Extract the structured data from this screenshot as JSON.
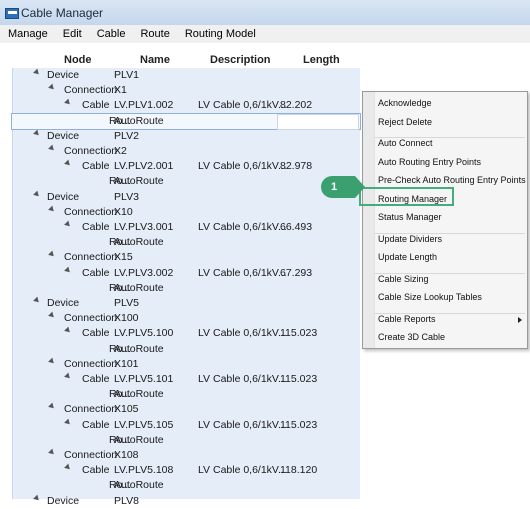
{
  "window": {
    "title": "Cable Manager"
  },
  "menubar": {
    "items": [
      "Manage",
      "Edit",
      "Cable",
      "Route",
      "Routing Model"
    ]
  },
  "grid": {
    "columns": [
      "Node",
      "Name",
      "Description",
      "Length"
    ],
    "rows": [
      {
        "node": "Device",
        "name": "PLV1",
        "desc": "",
        "len": "",
        "level": 0
      },
      {
        "node": "Connection",
        "name": "X1",
        "desc": "",
        "len": "",
        "level": 1
      },
      {
        "node": "Cable",
        "name": "LV.PLV1.002",
        "desc": "LV Cable 0,6/1kV...",
        "len": "82.202",
        "level": 2
      },
      {
        "node": "Ro...",
        "name": "AutoRoute",
        "desc": "",
        "len": "",
        "level": 3,
        "selected": true
      },
      {
        "node": "Device",
        "name": "PLV2",
        "desc": "",
        "len": "",
        "level": 0
      },
      {
        "node": "Connection",
        "name": "X2",
        "desc": "",
        "len": "",
        "level": 1
      },
      {
        "node": "Cable",
        "name": "LV.PLV2.001",
        "desc": "LV Cable 0,6/1kV...",
        "len": "82.978",
        "level": 2
      },
      {
        "node": "Ro...",
        "name": "AutoRoute",
        "desc": "",
        "len": "",
        "level": 3
      },
      {
        "node": "Device",
        "name": "PLV3",
        "desc": "",
        "len": "",
        "level": 0
      },
      {
        "node": "Connection",
        "name": "X10",
        "desc": "",
        "len": "",
        "level": 1
      },
      {
        "node": "Cable",
        "name": "LV.PLV3.001",
        "desc": "LV Cable 0,6/1kV...",
        "len": "66.493",
        "level": 2
      },
      {
        "node": "Ro...",
        "name": "AutoRoute",
        "desc": "",
        "len": "",
        "level": 3
      },
      {
        "node": "Connection",
        "name": "X15",
        "desc": "",
        "len": "",
        "level": 1
      },
      {
        "node": "Cable",
        "name": "LV.PLV3.002",
        "desc": "LV Cable 0,6/1kV...",
        "len": "67.293",
        "level": 2
      },
      {
        "node": "Ro...",
        "name": "AutoRoute",
        "desc": "",
        "len": "",
        "level": 3
      },
      {
        "node": "Device",
        "name": "PLV5",
        "desc": "",
        "len": "",
        "level": 0
      },
      {
        "node": "Connection",
        "name": "X100",
        "desc": "",
        "len": "",
        "level": 1
      },
      {
        "node": "Cable",
        "name": "LV.PLV5.100",
        "desc": "LV Cable 0,6/1kV...",
        "len": "115.023",
        "level": 2
      },
      {
        "node": "Ro...",
        "name": "AutoRoute",
        "desc": "",
        "len": "",
        "level": 3
      },
      {
        "node": "Connection",
        "name": "X101",
        "desc": "",
        "len": "",
        "level": 1
      },
      {
        "node": "Cable",
        "name": "LV.PLV5.101",
        "desc": "LV Cable 0,6/1kV...",
        "len": "115.023",
        "level": 2
      },
      {
        "node": "Ro...",
        "name": "AutoRoute",
        "desc": "",
        "len": "",
        "level": 3
      },
      {
        "node": "Connection",
        "name": "X105",
        "desc": "",
        "len": "",
        "level": 1
      },
      {
        "node": "Cable",
        "name": "LV.PLV5.105",
        "desc": "LV Cable 0,6/1kV...",
        "len": "115.023",
        "level": 2
      },
      {
        "node": "Ro...",
        "name": "AutoRoute",
        "desc": "",
        "len": "",
        "level": 3
      },
      {
        "node": "Connection",
        "name": "X108",
        "desc": "",
        "len": "",
        "level": 1
      },
      {
        "node": "Cable",
        "name": "LV.PLV5.108",
        "desc": "LV Cable 0,6/1kV...",
        "len": "118.120",
        "level": 2
      },
      {
        "node": "Ro...",
        "name": "AutoRoute",
        "desc": "",
        "len": "",
        "level": 3
      },
      {
        "node": "Device",
        "name": "PLV8",
        "desc": "",
        "len": "",
        "level": 0
      }
    ]
  },
  "context_menu": {
    "items": [
      {
        "label": "Acknowledge"
      },
      {
        "label": "Reject Delete"
      },
      {
        "sep": true
      },
      {
        "label": "Auto Connect"
      },
      {
        "label": "Auto Routing Entry Points"
      },
      {
        "label": "Pre-Check Auto Routing Entry Points"
      },
      {
        "label": "Routing Manager",
        "highlighted": true
      },
      {
        "label": "Status Manager"
      },
      {
        "sep": true
      },
      {
        "label": "Update Dividers"
      },
      {
        "label": "Update Length"
      },
      {
        "sep": true
      },
      {
        "label": "Cable Sizing"
      },
      {
        "label": "Cable Size Lookup Tables"
      },
      {
        "sep": true
      },
      {
        "label": "Cable Reports",
        "submenu": true
      },
      {
        "label": "Create 3D Cable"
      }
    ]
  },
  "callout": {
    "label": "1"
  },
  "colors": {
    "callout": "#3aa06f",
    "highlight": "#44ad7c",
    "grid_bg": "#e4edf8"
  }
}
